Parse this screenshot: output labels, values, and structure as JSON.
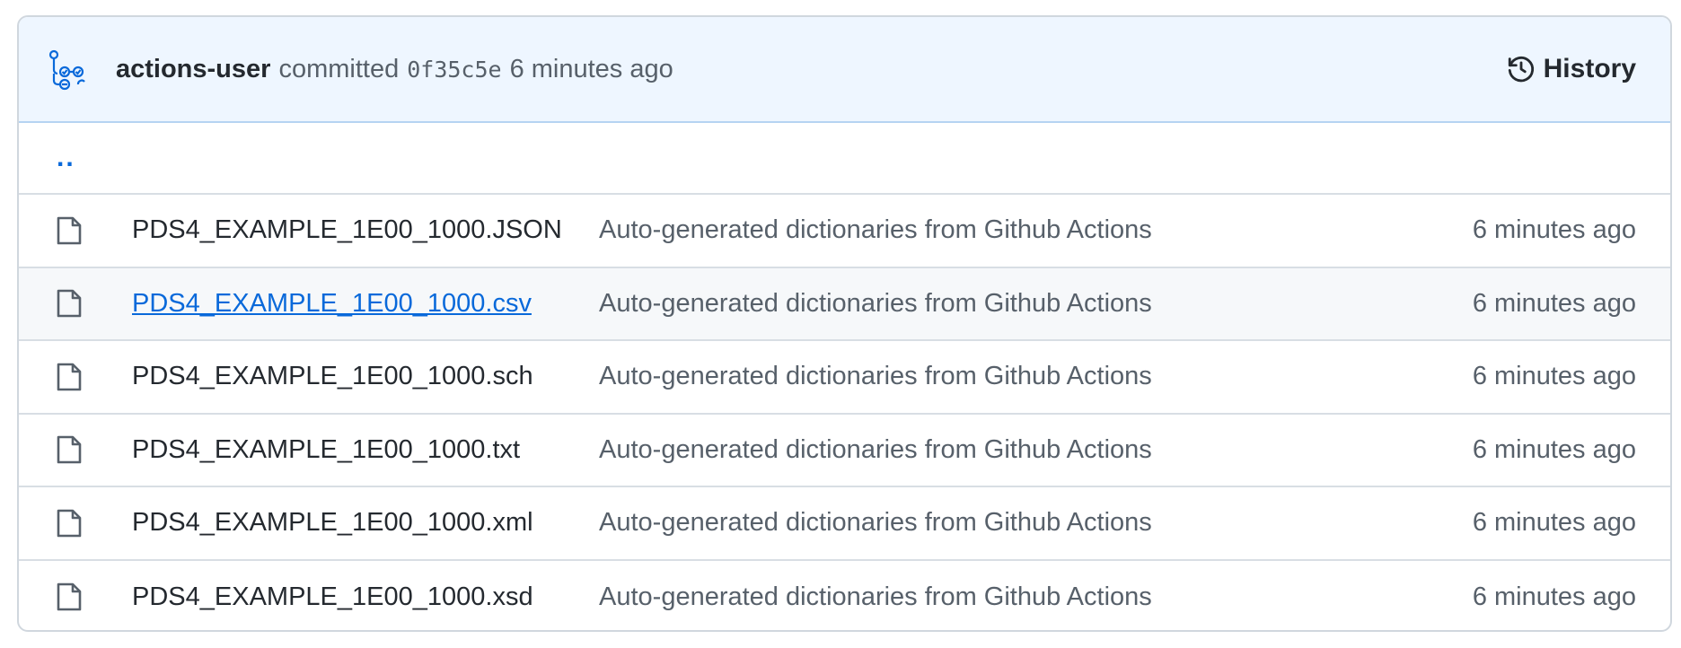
{
  "header": {
    "author": "actions-user",
    "verb": "committed",
    "sha": "0f35c5e",
    "time": "6 minutes ago",
    "history_label": "History"
  },
  "parent_dir": "..",
  "files": [
    {
      "name": "PDS4_EXAMPLE_1E00_1000.JSON",
      "message": "Auto-generated dictionaries from Github Actions",
      "age": "6 minutes ago"
    },
    {
      "name": "PDS4_EXAMPLE_1E00_1000.csv",
      "message": "Auto-generated dictionaries from Github Actions",
      "age": "6 minutes ago"
    },
    {
      "name": "PDS4_EXAMPLE_1E00_1000.sch",
      "message": "Auto-generated dictionaries from Github Actions",
      "age": "6 minutes ago"
    },
    {
      "name": "PDS4_EXAMPLE_1E00_1000.txt",
      "message": "Auto-generated dictionaries from Github Actions",
      "age": "6 minutes ago"
    },
    {
      "name": "PDS4_EXAMPLE_1E00_1000.xml",
      "message": "Auto-generated dictionaries from Github Actions",
      "age": "6 minutes ago"
    },
    {
      "name": "PDS4_EXAMPLE_1E00_1000.xsd",
      "message": "Auto-generated dictionaries from Github Actions",
      "age": "6 minutes ago"
    }
  ],
  "colors": {
    "header_bg": "#eef6ff",
    "link": "#0969da",
    "muted": "#57606a",
    "border": "#d0d7de"
  },
  "icons": {
    "avatar": "github-actions-avatar-icon",
    "history": "history-clock-icon",
    "file": "file-icon"
  }
}
